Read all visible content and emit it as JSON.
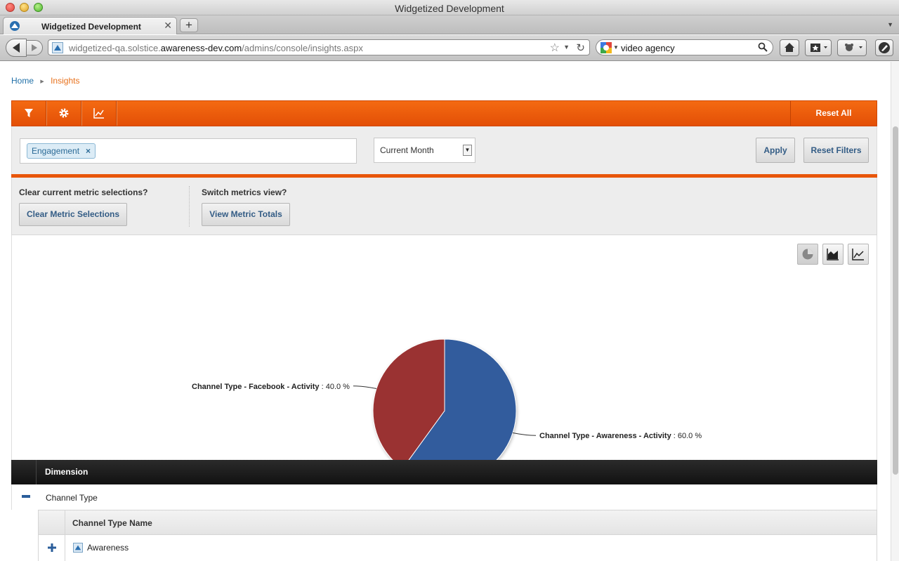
{
  "window": {
    "title": "Widgetized Development"
  },
  "browser": {
    "tab_title": "Widgetized Development",
    "tab_close": "✕",
    "new_tab": "+",
    "url_prefix": "widgetized-qa.solstice.",
    "url_domain": "awareness-dev.com",
    "url_path": "/admins/console/insights.aspx",
    "search_value": "video agency"
  },
  "breadcrumb": {
    "home": "Home",
    "current": "Insights"
  },
  "toolbar": {
    "reset_all": "Reset All"
  },
  "filters": {
    "tag_label": "Engagement",
    "tag_remove": "×",
    "period_value": "Current Month",
    "apply_label": "Apply",
    "reset_filters_label": "Reset Filters"
  },
  "metrics": {
    "clear_question": "Clear current metric selections?",
    "clear_button": "Clear Metric Selections",
    "switch_question": "Switch metrics view?",
    "switch_button": "View Metric Totals"
  },
  "chart_data": {
    "type": "pie",
    "slices": [
      {
        "label": "Channel Type - Awareness - Activity",
        "value": 60.0,
        "display": ": 60.0 %",
        "color": "#335c9d"
      },
      {
        "label": "Channel Type - Facebook - Activity",
        "value": 40.0,
        "display": ": 40.0 %",
        "color": "#9a3132"
      }
    ],
    "legend": "none"
  },
  "grid": {
    "header": "Dimension",
    "row_label": "Channel Type",
    "sub_header": "Channel Type Name",
    "sub_row_label": "Awareness"
  },
  "colors": {
    "accent": "#e8560a",
    "link": "#1f6fa7",
    "breadcrumb_current": "#e8711c"
  }
}
